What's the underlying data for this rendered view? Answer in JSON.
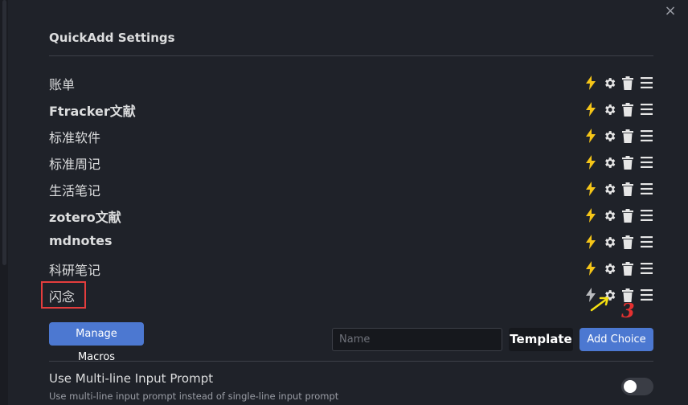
{
  "dialog": {
    "close_glyph": "×",
    "title": "QuickAdd Settings"
  },
  "choices": [
    {
      "label": "账单",
      "bold": false
    },
    {
      "label": "Ftracker文献",
      "bold": true
    },
    {
      "label": "标准软件",
      "bold": false
    },
    {
      "label": "标准周记",
      "bold": false
    },
    {
      "label": "生活笔记",
      "bold": false
    },
    {
      "label": "zotero文献",
      "bold": true
    },
    {
      "label": "mdnotes",
      "bold": true
    },
    {
      "label": "科研笔记",
      "bold": false
    },
    {
      "label": "闪念",
      "bold": false
    }
  ],
  "row_icons": [
    "lightning-icon",
    "gear-icon",
    "trash-icon",
    "drag-handle-icon"
  ],
  "colors": {
    "lightning_active": "#f5c518",
    "lightning_inactive": "#b9bbbe",
    "accent": "#4c78d1",
    "annotation_red": "#e43030",
    "annotation_arrow": "#f5e011"
  },
  "annotation": {
    "number": "3"
  },
  "controls": {
    "manage_macros_label": "Manage Macros",
    "name_placeholder": "Name",
    "type_value": "Template",
    "add_choice_label": "Add Choice"
  },
  "setting": {
    "name": "Use Multi-line Input Prompt",
    "description": "Use multi-line input prompt instead of single-line input prompt",
    "enabled": false
  }
}
